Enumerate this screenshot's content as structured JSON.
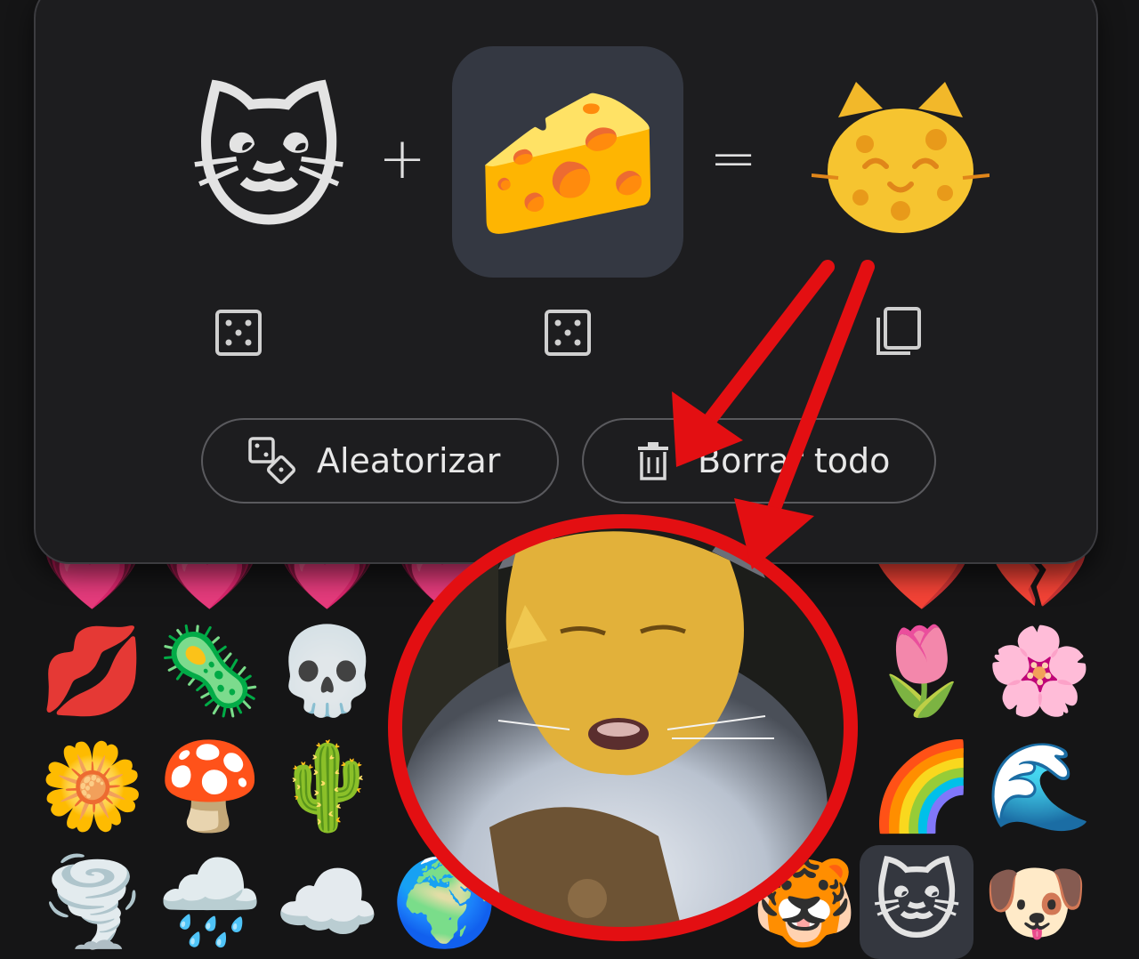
{
  "mixer": {
    "first_emoji": "🐱",
    "plus_sign": "+",
    "second_emoji": "🧀",
    "equals_sign": "=",
    "result_emoji": "🐱🧀",
    "randomize_label": "Aleatorizar",
    "clear_label": "Borrar todo"
  },
  "picker": {
    "rows": [
      [
        "💋",
        "🦠",
        "💀",
        "🌷",
        "🌸"
      ],
      [
        "🌼",
        "🍄",
        "🌵",
        "🌈",
        "🌊"
      ],
      [
        "🌪️",
        "🌧️",
        "☁️",
        "🌍",
        "🐯",
        "🐱",
        "🐶"
      ]
    ],
    "selected_emoji": "🐱",
    "partial_top_row": [
      "💗",
      "💗",
      "💗",
      "💗",
      "❤️",
      "💔"
    ]
  },
  "colors": {
    "background": "#151516",
    "card": "#1d1d1f",
    "selected_tile": "#343842",
    "annotation_red": "#e30f12"
  },
  "icons": {
    "first_slot_action": "dice-icon",
    "second_slot_action": "dice-icon",
    "result_action": "copy-icon",
    "randomize_button": "dice-pair-icon",
    "clear_button": "trash-icon"
  }
}
